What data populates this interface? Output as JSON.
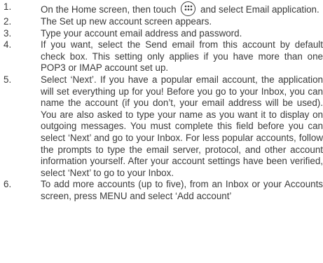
{
  "steps": [
    {
      "num": "1.",
      "before_icon": "On the Home screen, then touch",
      "icon": "apps-grid-icon",
      "after_icon": "and select Email application."
    },
    {
      "num": "2.",
      "text": "The Set up new account screen appears."
    },
    {
      "num": "3.",
      "text": "Type your account email address and password."
    },
    {
      "num": "4.",
      "text": "If you want, select the Send email from this account by default check box. This setting only applies if you have more than one POP3 or IMAP account set up."
    },
    {
      "num": "5.",
      "text": "Select ‘Next’. If you have a popular email account, the application will set everything up for you! Before you go to your Inbox, you can name the account (if you don’t, your email address will be used). You are also asked to type your name as you want it to display on outgoing messages. You must complete this field before you can select ‘Next’ and go to your Inbox. For less popular accounts, follow the prompts to type the email server, protocol, and other account information yourself. After your account settings have been verified, select ‘Next’ to go to your Inbox."
    },
    {
      "num": "6.",
      "text": "To add more accounts (up to five), from an Inbox or your Accounts screen, press MENU and select ‘Add account’"
    }
  ]
}
